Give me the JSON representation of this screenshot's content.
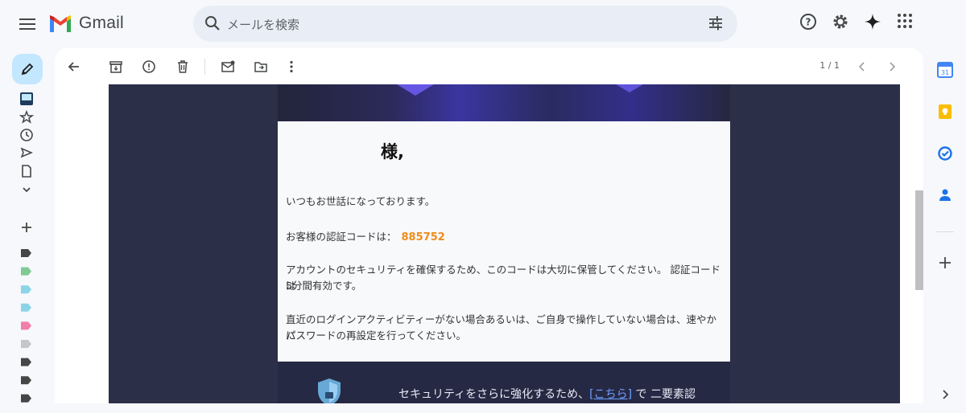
{
  "app": {
    "name": "Gmail"
  },
  "search": {
    "placeholder": "メールを検索"
  },
  "pager": {
    "text": "1 / 1"
  },
  "email": {
    "greeting": "様,",
    "line1": "いつもお世話になっております。",
    "code_label": "お客様の認証コードは：",
    "code": "885752",
    "line3a": "アカウントのセキュリティを確保するため、このコードは大切に保管してください。 認証コードは",
    "line3b": "5分間有効です。",
    "line4a": "直近のログインアクティビティーがない場合あるいは、ご自身で操作していない場合は、速やかに",
    "line4b": "パスワードの再設定を行ってください。",
    "footer_pre": "セキュリティをさらに強化するため、",
    "footer_link": "[こちら]",
    "footer_post": " で 二要素認"
  },
  "colors": {
    "accent": "#c2e7ff",
    "code": "#f08c1a",
    "link": "#6f9dff"
  },
  "labels": [
    {
      "color": "#444746"
    },
    {
      "color": "#81c995"
    },
    {
      "color": "#8ad4e6"
    },
    {
      "color": "#8ad4e6"
    },
    {
      "color": "#f27fa9"
    },
    {
      "color": "#c4c7c5"
    },
    {
      "color": "#444746"
    },
    {
      "color": "#444746"
    },
    {
      "color": "#444746"
    }
  ]
}
